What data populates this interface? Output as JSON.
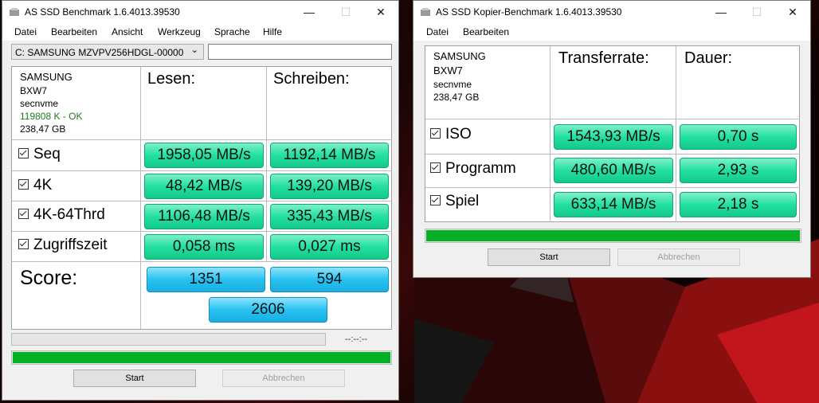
{
  "bench": {
    "title": "AS SSD Benchmark 1.6.4013.39530",
    "menu": [
      "Datei",
      "Bearbeiten",
      "Ansicht",
      "Werkzeug",
      "Sprache",
      "Hilfe"
    ],
    "drive_select": "C: SAMSUNG MZVPV256HDGL-00000",
    "drive_text": "",
    "info": {
      "brand": "SAMSUNG",
      "model": "BXW7",
      "driver": "secnvme",
      "status": "119808 K - OK",
      "size": "238,47 GB"
    },
    "col_read": "Lesen:",
    "col_write": "Schreiben:",
    "rows": [
      {
        "label": "Seq",
        "read": "1958,05 MB/s",
        "write": "1192,14 MB/s"
      },
      {
        "label": "4K",
        "read": "48,42 MB/s",
        "write": "139,20 MB/s"
      },
      {
        "label": "4K-64Thrd",
        "read": "1106,48 MB/s",
        "write": "335,43 MB/s"
      },
      {
        "label": "Zugriffszeit",
        "read": "0,058 ms",
        "write": "0,027 ms"
      }
    ],
    "score_label": "Score:",
    "score_read": "1351",
    "score_write": "594",
    "score_total": "2606",
    "time_text": "--:--:--",
    "progress_fraction": 1.0,
    "start_label": "Start",
    "cancel_label": "Abbrechen",
    "status_color": "#1e7a1e"
  },
  "copy": {
    "title": "AS SSD Kopier-Benchmark 1.6.4013.39530",
    "menu": [
      "Datei",
      "Bearbeiten"
    ],
    "info": {
      "brand": "SAMSUNG",
      "model": "BXW7",
      "driver": "secnvme",
      "size": "238,47 GB"
    },
    "col_rate": "Transferrate:",
    "col_time": "Dauer:",
    "rows": [
      {
        "label": "ISO",
        "rate": "1543,93 MB/s",
        "time": "0,70 s"
      },
      {
        "label": "Programm",
        "rate": "480,60 MB/s",
        "time": "2,93 s"
      },
      {
        "label": "Spiel",
        "rate": "633,14 MB/s",
        "time": "2,18 s"
      }
    ],
    "progress_fraction": 1.0,
    "start_label": "Start",
    "cancel_label": "Abbrechen"
  },
  "colors": {
    "green_value": "#22e0a0",
    "blue_score": "#27c2f2",
    "progress": "#06b025"
  },
  "window_controls": {
    "minimize": "—",
    "maximize": "☐",
    "close": "✕"
  }
}
